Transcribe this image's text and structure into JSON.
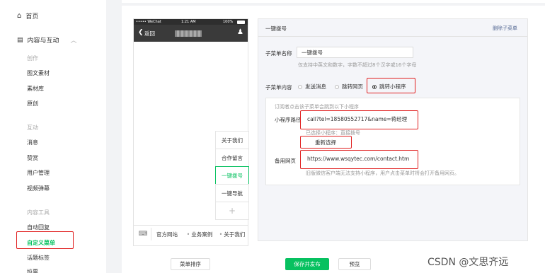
{
  "sidebar": {
    "home": "首页",
    "content_section": "内容与互动",
    "groups": [
      {
        "title": "创作",
        "items": [
          "图文素材",
          "素材库",
          "原创"
        ]
      },
      {
        "title": "互动",
        "items": [
          "消息",
          "赞赏",
          "用户管理",
          "视频弹幕"
        ]
      },
      {
        "title": "内容工具",
        "items": [
          "自动回复",
          "自定义菜单",
          "话题标签",
          "投票"
        ]
      }
    ],
    "active_item": "自定义菜单"
  },
  "phone": {
    "carrier": "••••• WeChat",
    "time": "1:21 AM",
    "battery": "100%",
    "back_label": "返回",
    "submenu_items": [
      "关于我们",
      "合作留言",
      "一键拨号",
      "一键导航"
    ],
    "add_symbol": "+",
    "bottom_tabs": [
      "官方网站",
      "业务案例",
      "关于我们"
    ]
  },
  "panel": {
    "title": "一键拨号",
    "delete_link": "删除子菜单",
    "name_label": "子菜单名称",
    "name_value": "一键拨号",
    "name_hint": "仅支持中英文和数字，字数不超过8个汉字或16个字母",
    "content_label": "子菜单内容",
    "options": [
      "发送消息",
      "跳转网页",
      "跳转小程序"
    ],
    "selected_option": "跳转小程序",
    "subscriber_hint": "订阅者点击该子菜单会跳到以下小程序",
    "path_label": "小程序路径",
    "path_value": "call?tel=18580552717&name=蒋经理",
    "selected_hint": "已选择小程序：直接拨号",
    "reselect_label": "重新选择",
    "backup_label": "备用网页",
    "backup_value": "https://www.wsqytec.com/contact.htm",
    "backup_hint": "旧版微信客户端无法支持小程序，用户点击菜单时将会打开备用网页。"
  },
  "footer": {
    "sort_button": "菜单排序",
    "save_button": "保存并发布",
    "preview_button": "预览"
  },
  "watermark": "CSDN @文思齐远",
  "colors": {
    "accent": "#07c160",
    "highlight": "#e02020",
    "link": "#576b95"
  }
}
